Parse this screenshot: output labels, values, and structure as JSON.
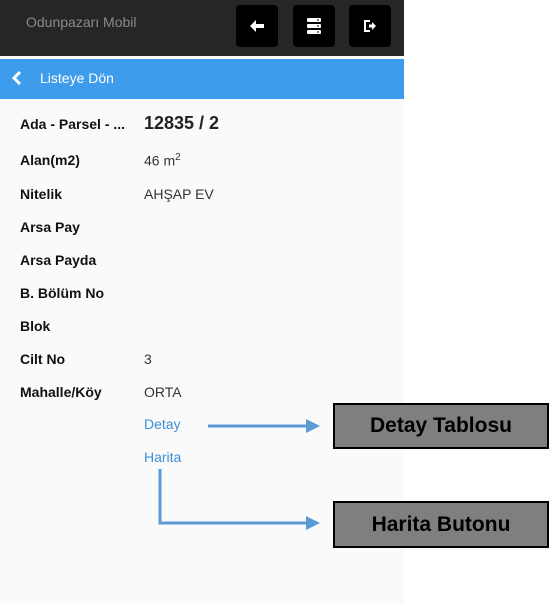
{
  "header": {
    "app_title": "Odunpazarı Mobil"
  },
  "toolbar": {
    "buttons": [
      {
        "icon": "arrow-left-icon"
      },
      {
        "icon": "server-icon"
      },
      {
        "icon": "sign-out-icon"
      }
    ]
  },
  "nav": {
    "back_label": "Listeye Dön"
  },
  "details": {
    "ada_label": "Ada - Parsel - ...",
    "ada_value": "12835 / 2",
    "alan_label": "Alan(m2)",
    "alan_value": "46 m",
    "alan_unit_sup": "2",
    "nitelik_label": "Nitelik",
    "nitelik_value": "AHŞAP EV",
    "arsa_pay_label": "Arsa Pay",
    "arsa_payda_label": "Arsa Payda",
    "bolum_label": "B. Bölüm No",
    "blok_label": "Blok",
    "cilt_label": "Cilt No",
    "cilt_value": "3",
    "mahalle_label": "Mahalle/Köy",
    "mahalle_value": "ORTA"
  },
  "links": {
    "detay": "Detay",
    "harita": "Harita"
  },
  "annotations": {
    "detay_callout": "Detay Tablosu",
    "harita_callout": "Harita Butonu"
  },
  "colors": {
    "topbar": "#262626",
    "navbar": "#3d9cec",
    "link": "#3d8fd6",
    "callout_bg": "#7f7f7f",
    "arrow": "#5b9bd5"
  }
}
